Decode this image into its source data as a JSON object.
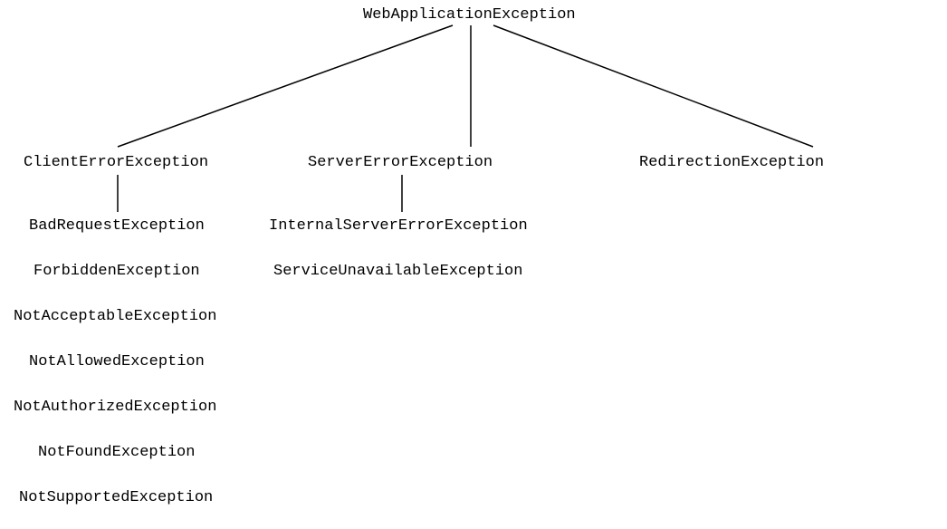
{
  "tree": {
    "root": "WebApplicationException",
    "children": [
      {
        "label": "ClientErrorException",
        "children": [
          "BadRequestException",
          "ForbiddenException",
          "NotAcceptableException",
          "NotAllowedException",
          "NotAuthorizedException",
          "NotFoundException",
          "NotSupportedException"
        ]
      },
      {
        "label": "ServerErrorException",
        "children": [
          "InternalServerErrorException",
          "ServiceUnavailableException"
        ]
      },
      {
        "label": "RedirectionException",
        "children": []
      }
    ]
  }
}
